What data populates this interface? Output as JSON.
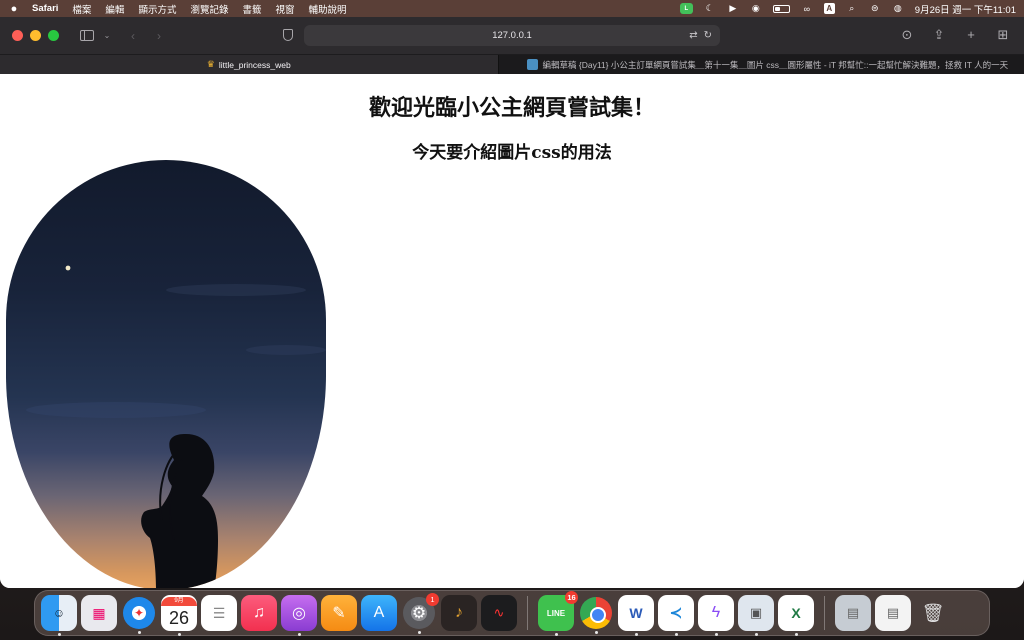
{
  "menubar": {
    "app_name": "Safari",
    "menu_items": [
      "檔案",
      "編輯",
      "顯示方式",
      "瀏覽記錄",
      "書籤",
      "視窗",
      "輔助說明"
    ],
    "clock": "9月26日 週一 下午11:01",
    "status_icons": [
      "line-icon",
      "moon-icon",
      "play-icon",
      "user-icon",
      "battery-icon",
      "link-icon",
      "input-A-icon",
      "search-icon",
      "control-center-icon",
      "siri-icon"
    ]
  },
  "browser": {
    "address": "127.0.0.1",
    "tabs": [
      {
        "title": "little_princess_web",
        "icon": "crown-icon",
        "active": true
      },
      {
        "title": "編輯草稿 {Day11} 小公主訂單網頁嘗試集＿第十一集＿圖片 css＿圓形屬性 - iT 邦幫忙::一起幫忙解決難題，拯救 IT 人的一天",
        "icon": "ithome-icon",
        "active": false
      }
    ]
  },
  "page": {
    "heading": "歡迎光臨小公主網頁嘗試集！",
    "subheading": "今天要介紹圖片css的用法",
    "image_description_icon": "silhouette-photo"
  },
  "dock": {
    "calendar_month": "9月",
    "calendar_day": "26",
    "settings_badge": "1",
    "line_badge": "16",
    "line_label": "LINE",
    "word_label": "W",
    "excel_label": "X"
  },
  "colors": {
    "menubar": "#5a3f37",
    "toolbar": "#2d2b2e",
    "close": "#fe5f57",
    "minimize": "#febc2e",
    "zoom": "#28c840"
  }
}
